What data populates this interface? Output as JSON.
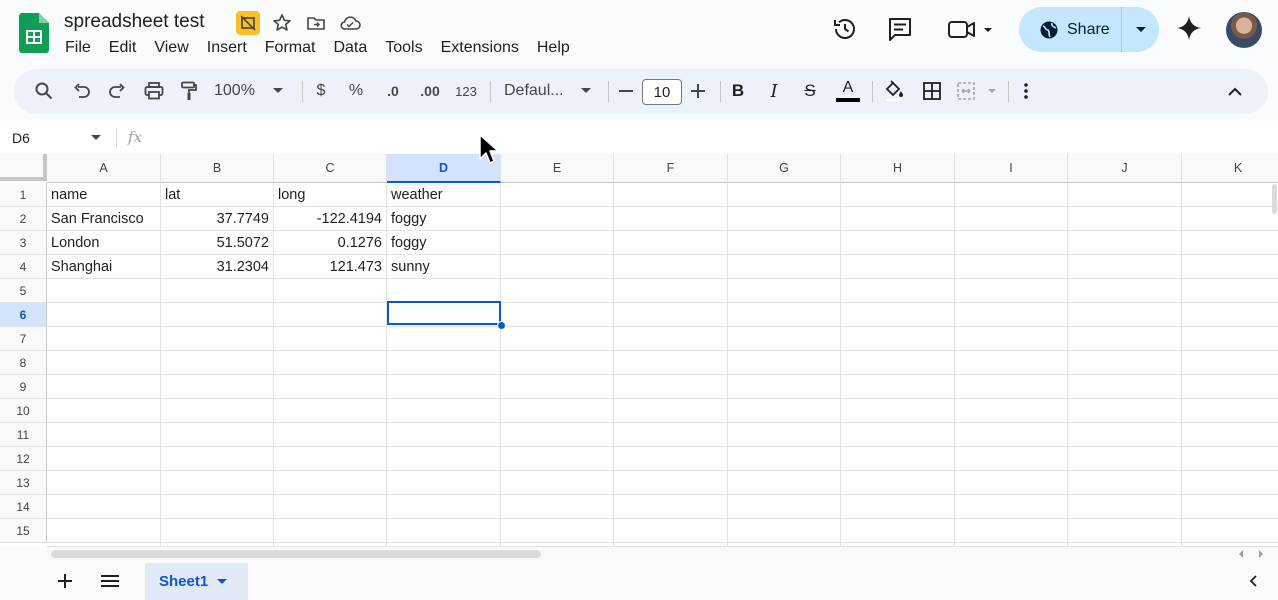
{
  "app": {
    "title": "spreadsheet test",
    "menu": [
      "File",
      "Edit",
      "View",
      "Insert",
      "Format",
      "Data",
      "Tools",
      "Extensions",
      "Help"
    ],
    "share_label": "Share",
    "brand_color": "#0f9d58",
    "accent_color": "#0b57d0"
  },
  "toolbar": {
    "zoom": "100%",
    "currency": "$",
    "percent": "%",
    "dec_decrease": ".0",
    "dec_increase": ".00",
    "number_format": "123",
    "font_family": "Defaul...",
    "font_size": "10",
    "bold": "B",
    "italic": "I",
    "strike": "S",
    "text_color": "A"
  },
  "formula_bar": {
    "name_box": "D6",
    "fx": "fx"
  },
  "grid": {
    "columns": [
      "A",
      "B",
      "C",
      "D",
      "E",
      "F",
      "G",
      "H",
      "I",
      "J",
      "K"
    ],
    "selected_column": "D",
    "rows": [
      "1",
      "2",
      "3",
      "4",
      "5",
      "6",
      "7",
      "8",
      "9",
      "10",
      "11",
      "12",
      "13",
      "14",
      "15"
    ],
    "selected_row": "6",
    "cells": {
      "A1": "name",
      "B1": "lat",
      "C1": "long",
      "D1": "weather",
      "A2": "San Francisco",
      "B2": "37.7749",
      "C2": "-122.4194",
      "D2": "foggy",
      "A3": "London",
      "B3": "51.5072",
      "C3": "0.1276",
      "D3": "foggy",
      "A4": "Shanghai",
      "B4": "31.2304",
      "C4": "121.473",
      "D4": "sunny"
    }
  },
  "sheets": {
    "active": "Sheet1"
  }
}
